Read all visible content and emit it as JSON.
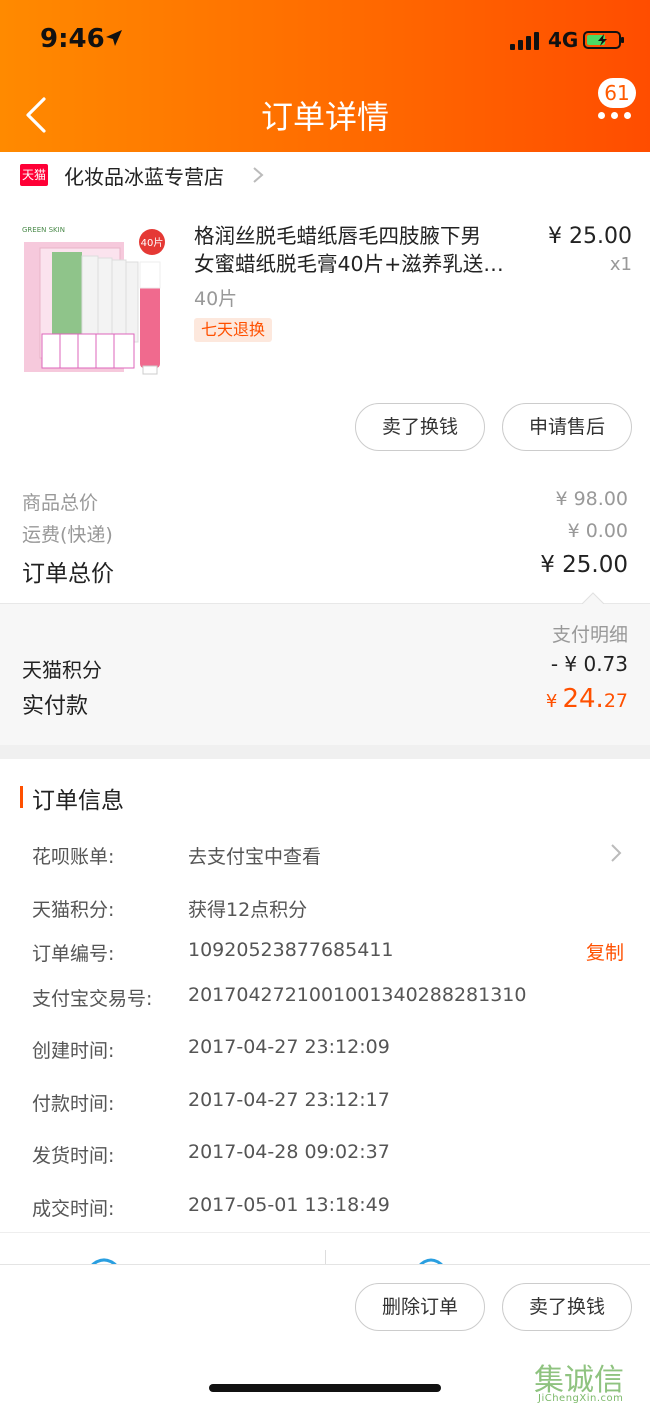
{
  "status_bar": {
    "time": "9:46",
    "network": "4G"
  },
  "header": {
    "title": "订单详情",
    "notification_count": "61"
  },
  "store": {
    "badge": "天猫",
    "name": "化妆品冰蓝专营店"
  },
  "product": {
    "title": "格润丝脱毛蜡纸唇毛四肢腋下男女蜜蜡纸脱毛膏40片+滋养乳送…",
    "title_line1": "格润丝脱毛蜡纸唇毛四肢腋下男",
    "title_line2": "女蜜蜡纸脱毛膏40片+滋养乳送…",
    "price": "¥ 25.00",
    "quantity": "x1",
    "sku": "40片",
    "tag": "七天退换",
    "image_text": {
      "brand": "GREEN SKIN",
      "badge": "40片"
    }
  },
  "item_actions": {
    "sell": "卖了换钱",
    "after_sale": "申请售后"
  },
  "summary": {
    "goods_label": "商品总价",
    "goods_value": "¥ 98.00",
    "shipping_label": "运费(快递)",
    "shipping_value": "¥ 0.00",
    "total_label": "订单总价",
    "total_value": "¥ 25.00"
  },
  "payment": {
    "detail_label": "支付明细",
    "points_label": "天猫积分",
    "points_value": "- ¥ 0.73",
    "paid_label": "实付款",
    "paid_currency": "¥",
    "paid_integer": "24.",
    "paid_decimal": "27"
  },
  "order_info": {
    "title": "订单信息",
    "rows": [
      {
        "label": "花呗账单:",
        "value": "去支付宝中查看"
      },
      {
        "label": "天猫积分:",
        "value": "获得12点积分"
      },
      {
        "label": "订单编号:",
        "value": "10920523877685411"
      },
      {
        "label": "支付宝交易号:",
        "value": "2017042721001001340288281310"
      },
      {
        "label": "创建时间:",
        "value": "2017-04-27 23:12:09"
      },
      {
        "label": "付款时间:",
        "value": "2017-04-27 23:12:17"
      },
      {
        "label": "发货时间:",
        "value": "2017-04-28 09:02:37"
      },
      {
        "label": "成交时间:",
        "value": "2017-05-01 13:18:49"
      }
    ],
    "copy_label": "复制"
  },
  "bottom_actions": {
    "delete": "删除订单",
    "sell": "卖了换钱"
  },
  "watermark": {
    "text": "JiChengXin.com",
    "chars": "集诚信"
  },
  "colors": {
    "accent": "#ff5000",
    "header_start": "#ff8a00",
    "header_end": "#ff4d00",
    "tmall": "#ff0036"
  }
}
